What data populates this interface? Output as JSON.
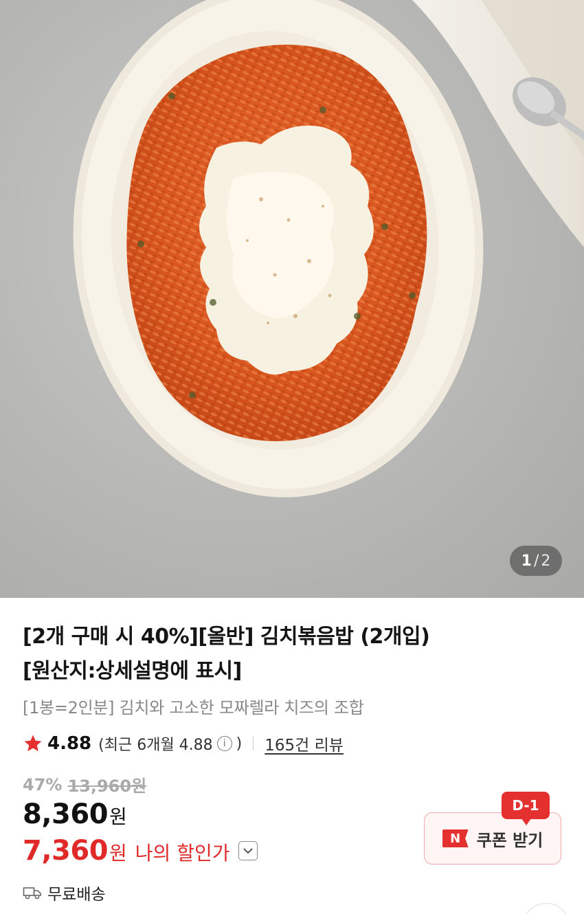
{
  "gallery": {
    "current_page": "1",
    "separator": "/",
    "total_pages": "2"
  },
  "product": {
    "title_line1": "[2개 구매 시 40%][올반] 김치볶음밥 (2개입)",
    "title_line2": "[원산지:상세설명에 표시]",
    "subtitle": "[1봉=2인분] 김치와 고소한 모짜렐라 치즈의 조합"
  },
  "rating": {
    "score": "4.88",
    "recent_prefix": "(최근 6개월 4.88",
    "recent_suffix": ")",
    "review_link": "165건 리뷰",
    "star_color": "#e53030"
  },
  "pricing": {
    "discount_rate": "47%",
    "original_price": "13,960원",
    "price": "8,360",
    "price_unit": "원",
    "my_price": "7,360",
    "my_price_unit": "원",
    "my_price_label": "나의 할인가",
    "accent_color": "#e02a2a"
  },
  "shipping": {
    "label": "무료배송"
  },
  "coupon": {
    "badge": "D-1",
    "n_icon": "N",
    "label": "쿠폰 받기"
  }
}
